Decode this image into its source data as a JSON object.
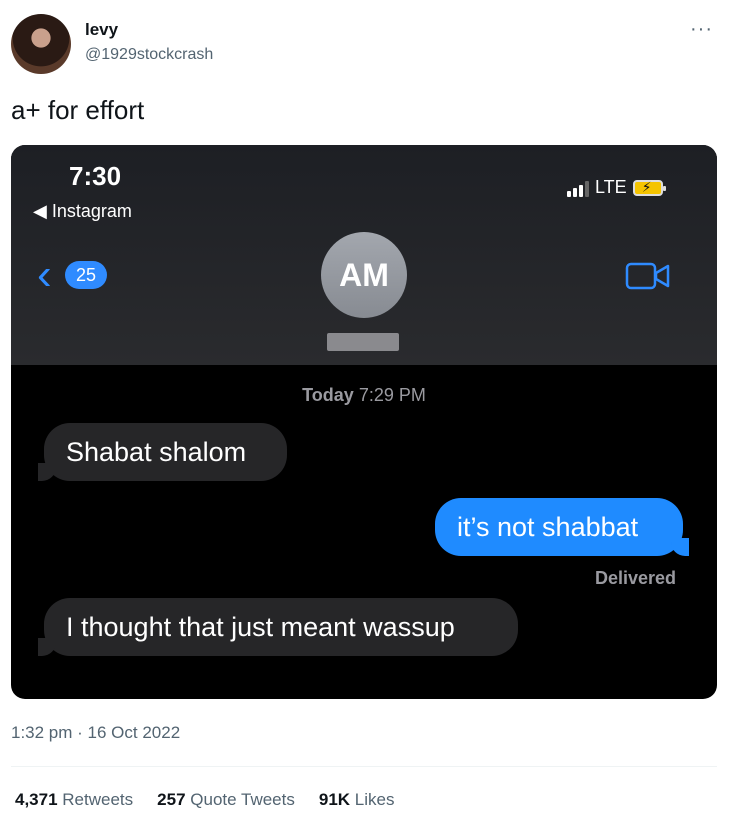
{
  "author": {
    "display_name": "levy",
    "handle": "@1929stockcrash",
    "avatar_icon": "profile-photo"
  },
  "more_icon": "ellipsis-icon",
  "tweet": {
    "text": "a+ for effort",
    "timestamp": "1:32 pm · 16 Oct 2022"
  },
  "phone_screenshot": {
    "status": {
      "time": "7:30",
      "back_app": "◀ Instagram",
      "network": "LTE"
    },
    "nav": {
      "back_count": "25",
      "contact_initials": "AM"
    },
    "conversation": {
      "timestamp_day": "Today",
      "timestamp_time": "7:29 PM",
      "messages": [
        {
          "direction": "incoming",
          "text": "Shabat shalom"
        },
        {
          "direction": "outgoing",
          "text": "it’s not shabbat"
        },
        {
          "direction": "incoming",
          "text": "I thought that just meant wassup"
        }
      ],
      "delivered_label": "Delivered"
    },
    "colors": {
      "ios_blue": "#1f8bff",
      "incoming_bubble": "#262628"
    }
  },
  "stats": {
    "retweets_count": "4,371",
    "retweets_label": "Retweets",
    "quotes_count": "257",
    "quotes_label": "Quote Tweets",
    "likes_count": "91K",
    "likes_label": "Likes"
  }
}
